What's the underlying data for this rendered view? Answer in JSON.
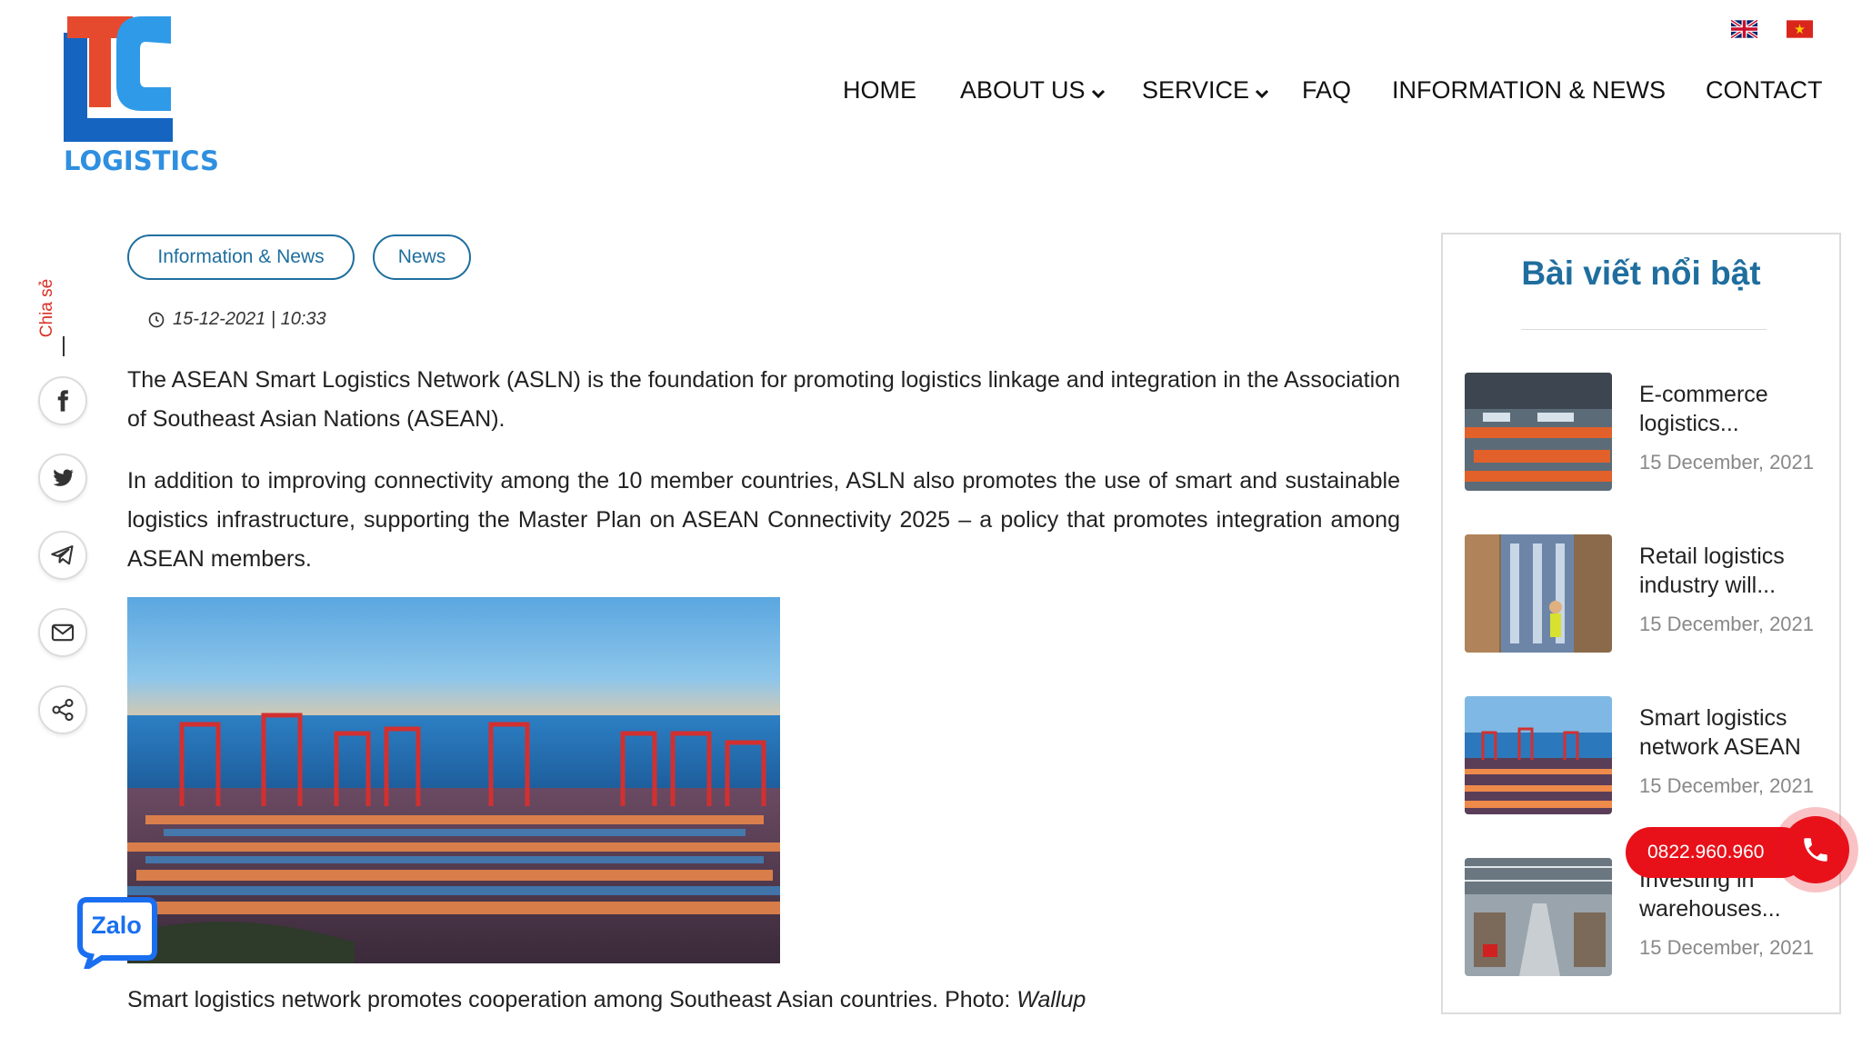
{
  "brand": {
    "logo_text": "LOGISTICS",
    "primary_color": "#1f6e9e",
    "accent_red": "#e8111a"
  },
  "languages": [
    {
      "code": "en",
      "icon": "uk-flag-icon"
    },
    {
      "code": "vi",
      "icon": "vietnam-flag-icon"
    }
  ],
  "nav": {
    "home": "HOME",
    "about": "ABOUT US",
    "service": "SERVICE",
    "faq": "FAQ",
    "info": "INFORMATION & NEWS",
    "contact": "CONTACT"
  },
  "share": {
    "label": "Chia sẻ",
    "items": [
      "facebook-icon",
      "twitter-icon",
      "telegram-icon",
      "email-icon",
      "share-icon"
    ]
  },
  "article": {
    "tags": [
      "Information & News",
      "News"
    ],
    "date": "15-12-2021 | 10:33",
    "paragraphs": [
      "The ASEAN Smart Logistics Network (ASLN) is the foundation for promoting logistics linkage and integration in the Association of Southeast Asian Nations (ASEAN).",
      "In addition to improving connectivity among the 10 member countries, ASLN also promotes the use of smart and sustainable logistics infrastructure, supporting the Master Plan on ASEAN Connectivity 2025 – a policy that promotes integration among ASEAN members."
    ],
    "caption": "Smart logistics network promotes cooperation among Southeast Asian countries. Photo: ",
    "caption_source": "Wallup"
  },
  "sidebar": {
    "title": "Bài viết nổi bật",
    "posts": [
      {
        "title": "E-commerce logistics...",
        "date": "15 December, 2021"
      },
      {
        "title": "Retail logistics industry will...",
        "date": "15 December, 2021"
      },
      {
        "title": "Smart logistics network ASEAN",
        "date": "15 December, 2021"
      },
      {
        "title": "Investing in warehouses...",
        "date": "15 December, 2021"
      }
    ]
  },
  "floating": {
    "zalo_label": "Zalo",
    "phone": "0822.960.960"
  }
}
